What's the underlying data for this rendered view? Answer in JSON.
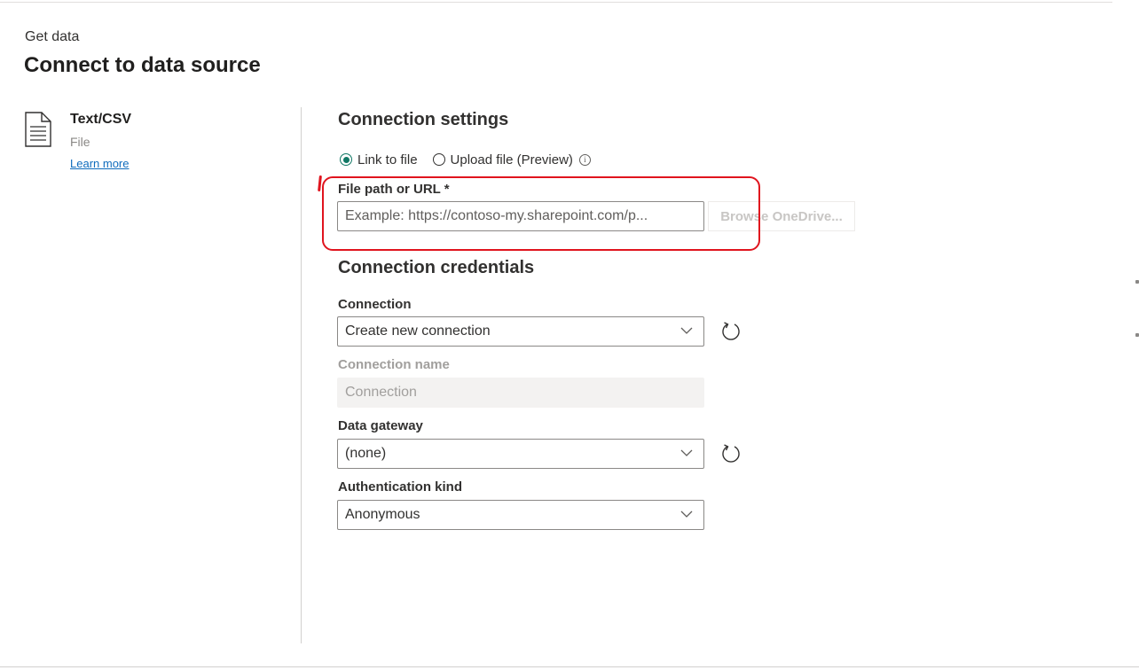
{
  "header": {
    "pre_title": "Get data",
    "title": "Connect to data source"
  },
  "connector": {
    "icon": "text-file-icon",
    "name": "Text/CSV",
    "type": "File",
    "learn_more": "Learn more"
  },
  "connection_settings": {
    "heading": "Connection settings",
    "options": [
      {
        "label": "Link to file",
        "selected": true
      },
      {
        "label": "Upload file (Preview)",
        "selected": false
      }
    ],
    "info_icon": "info-icon",
    "file_path_label": "File path or URL *",
    "file_path_placeholder": "Example: https://contoso-my.sharepoint.com/p...",
    "file_path_value": "",
    "browse_label": "Browse OneDrive..."
  },
  "connection_credentials": {
    "heading": "Connection credentials",
    "connection_label": "Connection",
    "connection_value": "Create new connection",
    "connection_name_label": "Connection name",
    "connection_name_placeholder": "Connection",
    "gateway_label": "Data gateway",
    "gateway_value": "(none)",
    "auth_label": "Authentication kind",
    "auth_value": "Anonymous"
  },
  "colors": {
    "accent": "#117865",
    "highlight": "#e0141e",
    "link": "#0f6cbd"
  }
}
